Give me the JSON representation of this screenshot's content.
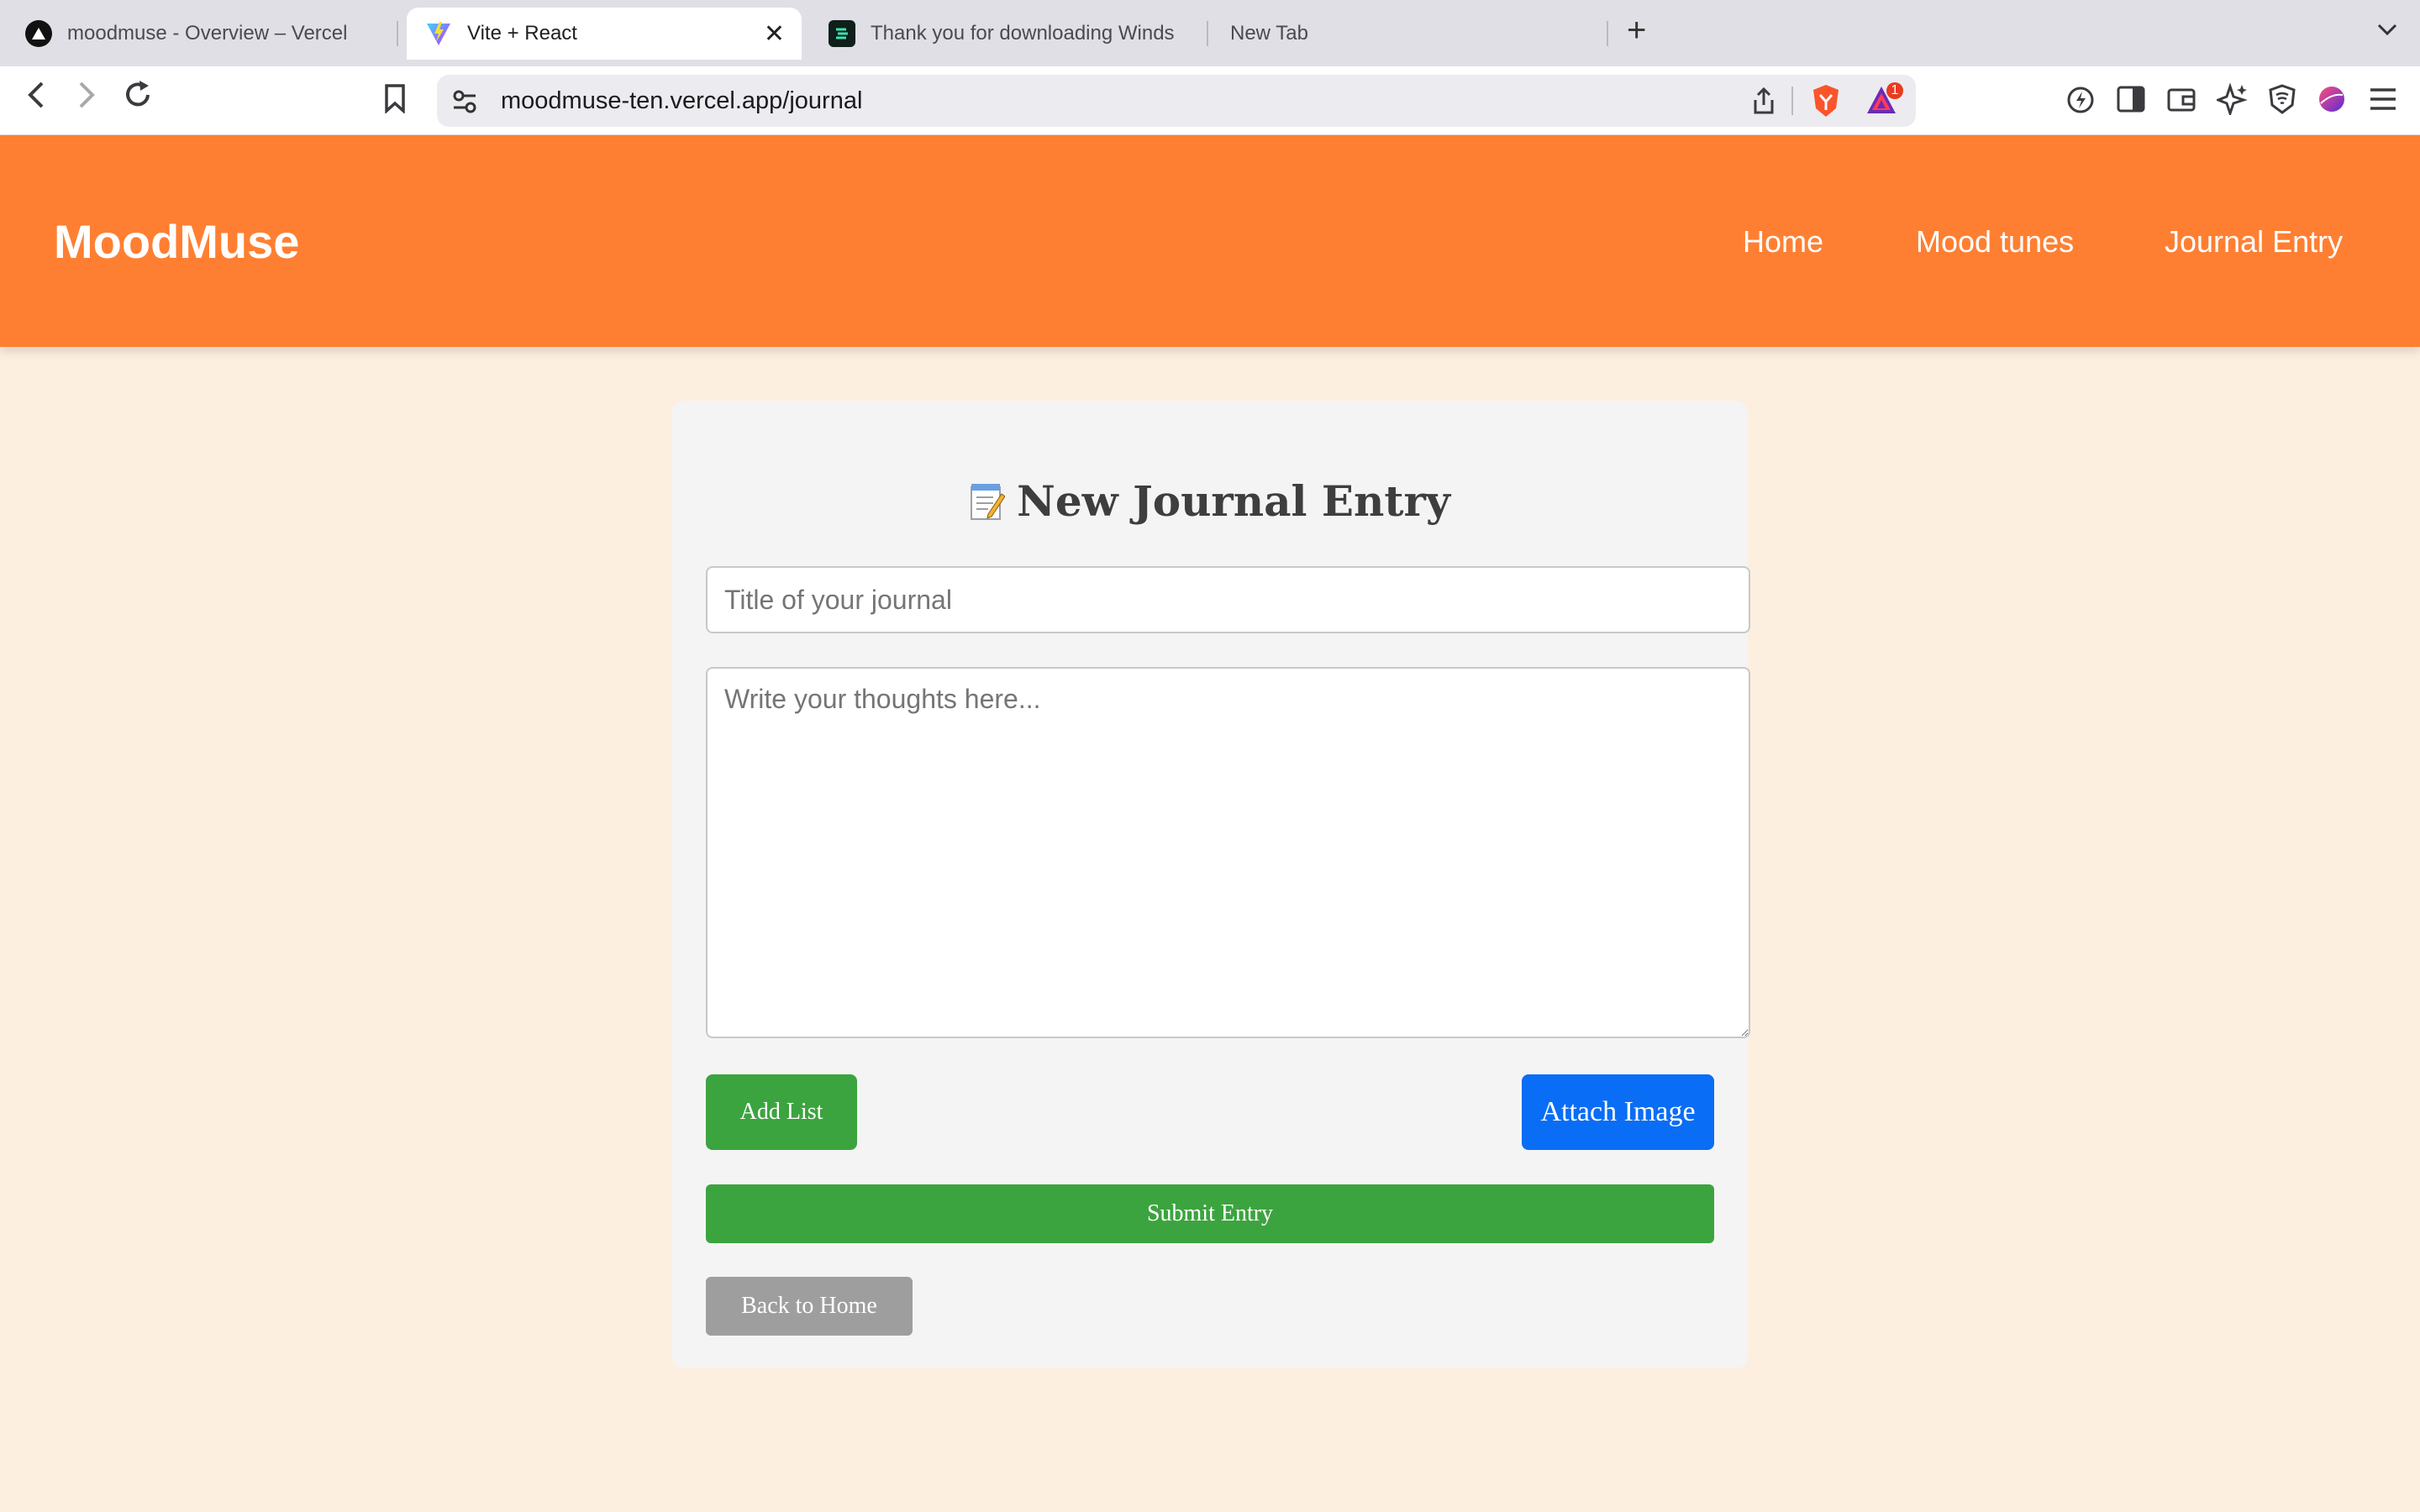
{
  "browser": {
    "tabs": [
      {
        "label": "moodmuse - Overview – Vercel",
        "icon": "vercel-icon"
      },
      {
        "label": "Vite + React",
        "icon": "vite-icon",
        "active": true
      },
      {
        "label": "Thank you for downloading Winds",
        "icon": "windsurf-icon"
      },
      {
        "label": "New Tab",
        "icon": ""
      }
    ],
    "url": "moodmuse-ten.vercel.app/journal",
    "notification_count": "1",
    "colors": {
      "tabbar": "#dfdfe5",
      "toolbar": "#ffffff",
      "brave_orange": "#fb542b"
    }
  },
  "site": {
    "brand": "MoodMuse",
    "nav": [
      "Home",
      "Mood tunes",
      "Journal Entry"
    ],
    "colors": {
      "header": "#ff7f32",
      "page_bg": "#fcefdf",
      "card_bg": "#f4f4f4"
    }
  },
  "journal": {
    "title_icon": "memo-icon",
    "title": "New Journal Entry",
    "title_placeholder": "Title of your journal",
    "body_placeholder": "Write your thoughts here...",
    "add_list_label": "Add List",
    "attach_image_label": "Attach Image",
    "submit_label": "Submit Entry",
    "back_label": "Back to Home",
    "colors": {
      "green": "#3ca43f",
      "blue": "#0a6df5",
      "grey": "#9e9e9e"
    }
  }
}
